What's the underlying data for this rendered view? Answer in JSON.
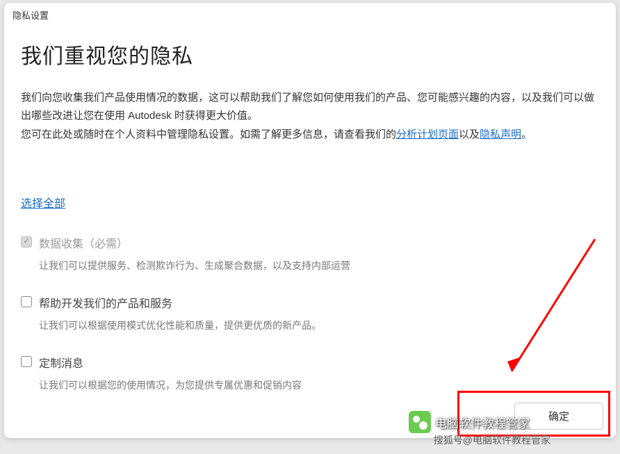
{
  "titleBar": "隐私设置",
  "heading": "我们重视您的隐私",
  "intro": {
    "p1": "我们向您收集我们产品使用情况的数据，这可以帮助我们了解您如何使用我们的产品、您可能感兴趣的内容，以及我们可以做出哪些改进让您在使用 Autodesk 时获得更大价值。",
    "p2_prefix": "您可在此处或随时在个人资料中管理隐私设置。如需了解更多信息，请查看我们的",
    "link_analytics": "分析计划页面",
    "p2_mid": "以及",
    "link_privacy": "隐私声明",
    "p2_suffix": "。"
  },
  "selectAll": "选择全部",
  "options": [
    {
      "label": "数据收集（必需）",
      "desc": "让我们可以提供服务、检测欺诈行为、生成聚合数据，以及支持内部运营",
      "checked": true,
      "disabled": true
    },
    {
      "label": "帮助开发我们的产品和服务",
      "desc": "让我们可以根据使用模式优化性能和质量，提供更优质的新产品。",
      "checked": false,
      "disabled": false
    },
    {
      "label": "定制消息",
      "desc": "让我们可以根据您的使用情况，为您提供专属优惠和促销内容",
      "checked": false,
      "disabled": false
    }
  ],
  "okButton": "确定",
  "watermark": {
    "main": "电脑软件教程管家",
    "sub": "搜狐号@电脑软件教程管家"
  }
}
